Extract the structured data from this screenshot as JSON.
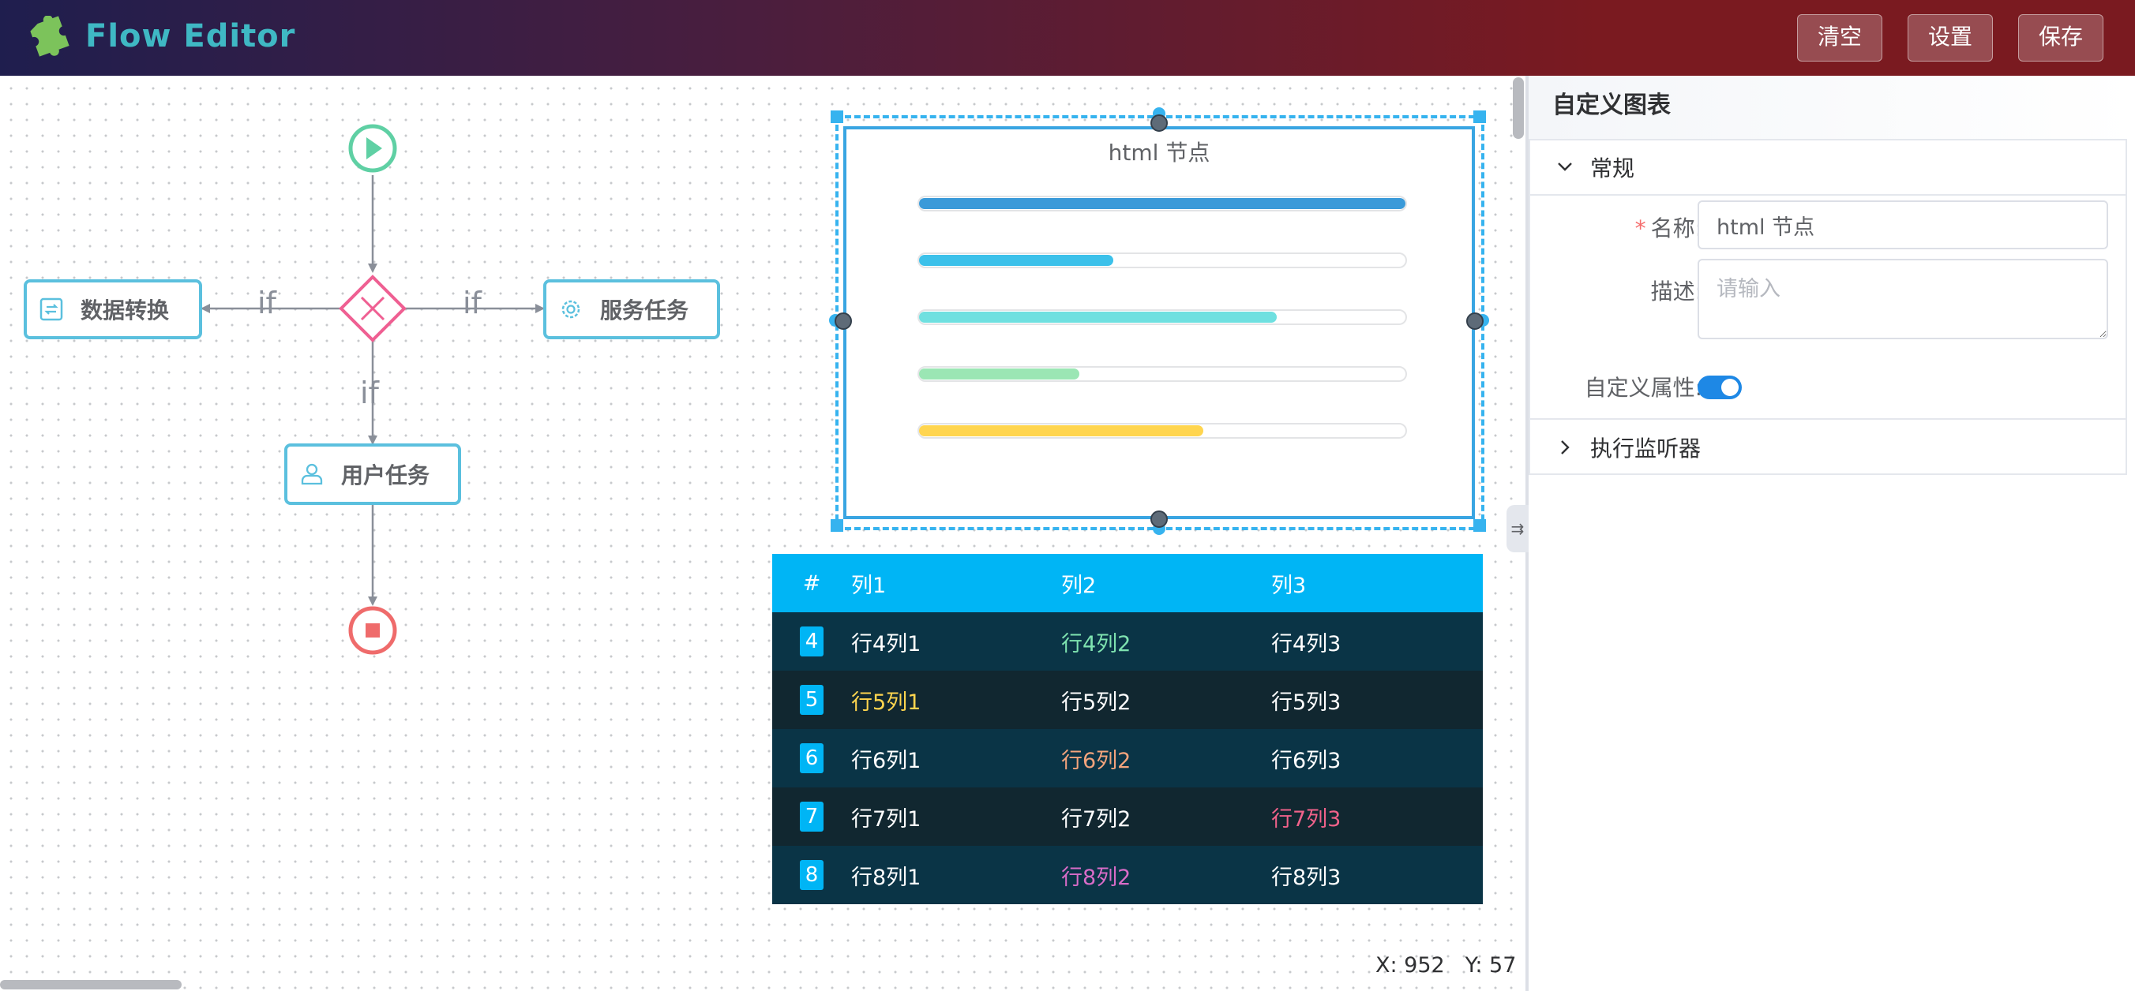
{
  "header": {
    "title": "Flow Editor",
    "buttons": {
      "clear": "清空",
      "settings": "设置",
      "save": "保存"
    },
    "logo_icon": "puzzle-icon"
  },
  "flow": {
    "start_event_icon": "play-icon",
    "gateway_icon": "exclusive-gateway-icon",
    "end_event_icon": "stop-icon",
    "tasks": {
      "data_transform": {
        "label": "数据转换",
        "icon": "transform-icon"
      },
      "service_task": {
        "label": "服务任务",
        "icon": "gear-icon"
      },
      "user_task": {
        "label": "用户任务",
        "icon": "user-icon"
      }
    },
    "edge_labels": {
      "left": "if",
      "right": "if",
      "down": "if"
    }
  },
  "html_node": {
    "title": "html 节点",
    "progress": [
      {
        "value": 1.0,
        "color": "#3a9ad9"
      },
      {
        "value": 0.4,
        "color": "#3cc1ea"
      },
      {
        "value": 0.735,
        "color": "#6fe0e0"
      },
      {
        "value": 0.33,
        "color": "#9be6b4"
      },
      {
        "value": 0.585,
        "color": "#ffd54f"
      }
    ]
  },
  "table": {
    "headers": [
      "#",
      "列1",
      "列2",
      "列3"
    ],
    "rows": [
      {
        "index": "4",
        "cells": [
          "行4列1",
          "行4列2",
          "行4列3"
        ],
        "highlight_col": 1,
        "highlight_color": "#7fe3b0"
      },
      {
        "index": "5",
        "cells": [
          "行5列1",
          "行5列2",
          "行5列3"
        ],
        "highlight_col": 0,
        "highlight_color": "#ffd54f"
      },
      {
        "index": "6",
        "cells": [
          "行6列1",
          "行6列2",
          "行6列3"
        ],
        "highlight_col": 1,
        "highlight_color": "#f4a47c"
      },
      {
        "index": "7",
        "cells": [
          "行7列1",
          "行7列2",
          "行7列3"
        ],
        "highlight_col": 2,
        "highlight_color": "#f0628a"
      },
      {
        "index": "8",
        "cells": [
          "行8列1",
          "行8列2",
          "行8列3"
        ],
        "highlight_col": 1,
        "highlight_color": "#d96cc8"
      }
    ]
  },
  "status": {
    "x": "X: 952",
    "y": "Y: 57"
  },
  "panel": {
    "title": "自定义图表",
    "sections": {
      "general": {
        "label": "常规",
        "expanded": true
      },
      "listeners": {
        "label": "执行监听器",
        "expanded": false
      }
    },
    "fields": {
      "name": {
        "label": "名称:",
        "value": "html 节点",
        "required": true
      },
      "desc": {
        "label": "描述:",
        "placeholder": "请输入"
      },
      "custom_attr": {
        "label": "自定义属性:",
        "enabled": true
      }
    }
  },
  "colors": {
    "accent": "#00b5f5",
    "selection": "#36b3ef",
    "task_border": "#5bc0de"
  }
}
